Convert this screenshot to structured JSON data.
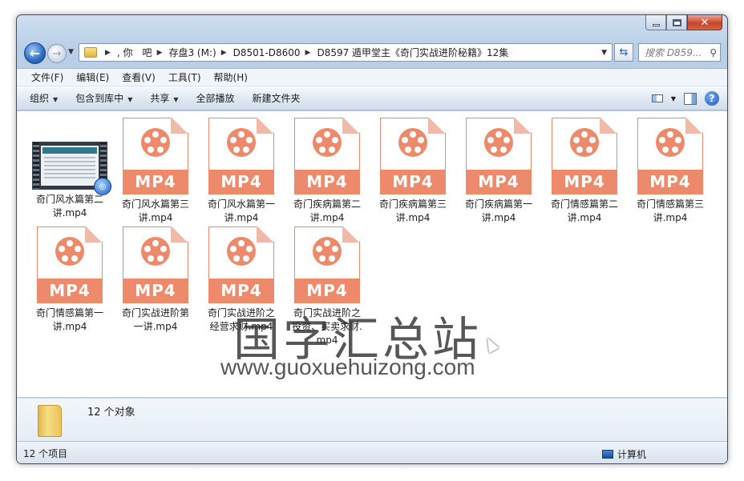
{
  "window": {
    "caption_buttons": {
      "minimize": "minimize",
      "maximize": "maximize",
      "close": "✕"
    }
  },
  "nav": {
    "back_icon": "back-arrow-icon",
    "forward_icon": "forward-arrow-icon"
  },
  "address": {
    "crumbs": [
      ", 你　吧",
      "存盘3 (M:)",
      "D8501-D8600",
      "D8597 遁甲堂主《奇门实战进阶秘籍》12集"
    ]
  },
  "search": {
    "placeholder": "搜索 D859..."
  },
  "menu": {
    "items": [
      "文件(F)",
      "编辑(E)",
      "查看(V)",
      "工具(T)",
      "帮助(H)"
    ]
  },
  "toolbar": {
    "organize": "组织",
    "include_library": "包含到库中",
    "share": "共享",
    "play_all": "全部播放",
    "new_folder": "新建文件夹"
  },
  "files": [
    {
      "name": "奇门风水篇第二讲.mp4",
      "icon": "video-thumbnail"
    },
    {
      "name": "奇门风水篇第三讲.mp4",
      "icon": "mp4-file",
      "badge": "MP4"
    },
    {
      "name": "奇门风水篇第一讲.mp4",
      "icon": "mp4-file",
      "badge": "MP4"
    },
    {
      "name": "奇门疾病篇第二讲.mp4",
      "icon": "mp4-file",
      "badge": "MP4"
    },
    {
      "name": "奇门疾病篇第三讲.mp4",
      "icon": "mp4-file",
      "badge": "MP4"
    },
    {
      "name": "奇门疾病篇第一讲.mp4",
      "icon": "mp4-file",
      "badge": "MP4"
    },
    {
      "name": "奇门情感篇第二讲.mp4",
      "icon": "mp4-file",
      "badge": "MP4"
    },
    {
      "name": "奇门情感篇第三讲.mp4",
      "icon": "mp4-file",
      "badge": "MP4"
    },
    {
      "name": "奇门情感篇第一讲.mp4",
      "icon": "mp4-file",
      "badge": "MP4"
    },
    {
      "name": "奇门实战进阶第一讲.mp4",
      "icon": "mp4-file",
      "badge": "MP4"
    },
    {
      "name": "奇门实战进阶之经营求财.mp4",
      "icon": "mp4-file",
      "badge": "MP4"
    },
    {
      "name": "奇门实战进阶之投资、买卖求财.mp4",
      "icon": "mp4-file",
      "badge": "MP4"
    }
  ],
  "watermark": {
    "title": "国字汇总站",
    "url": "www.guoxuehuizong.com"
  },
  "details": {
    "count": "12 个对象"
  },
  "status": {
    "items": "12 个项目",
    "location": "计算机"
  },
  "colors": {
    "mp4_accent": "#ee8a6c",
    "window_frame": "#bcd0e6"
  }
}
